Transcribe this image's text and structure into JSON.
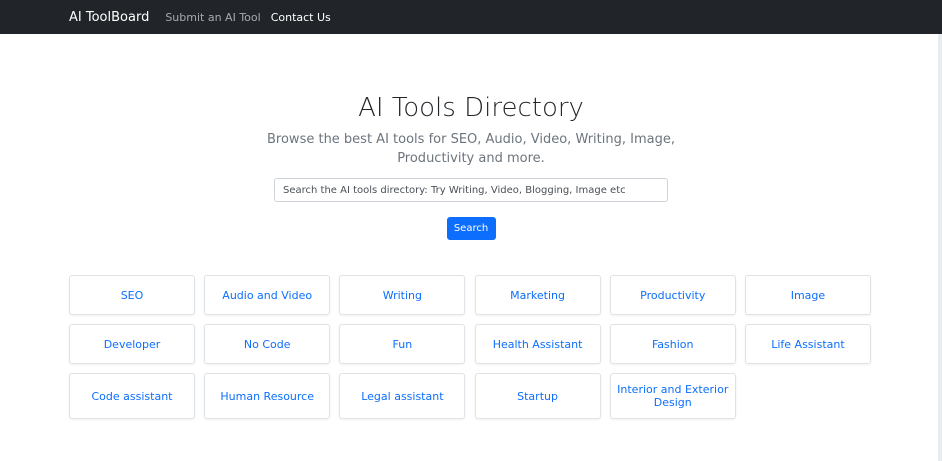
{
  "navbar": {
    "brand": "AI ToolBoard",
    "links": [
      "Submit an AI Tool",
      "Contact Us"
    ]
  },
  "hero": {
    "title": "AI Tools Directory",
    "subtitle": "Browse the best AI tools for SEO, Audio, Video, Writing, Image, Productivity and more.",
    "search_placeholder": "Search the AI tools directory: Try Writing, Video, Blogging, Image etc",
    "search_button": "Search"
  },
  "categories": [
    "SEO",
    "Audio and Video",
    "Writing",
    "Marketing",
    "Productivity",
    "Image",
    "Developer",
    "No Code",
    "Fun",
    "Health Assistant",
    "Fashion",
    "Life Assistant",
    "Code assistant",
    "Human Resource",
    "Legal assistant",
    "Startup",
    "Interior and Exterior Design"
  ],
  "colors": {
    "navbar_bg": "#212529",
    "accent": "#0d6efd"
  }
}
